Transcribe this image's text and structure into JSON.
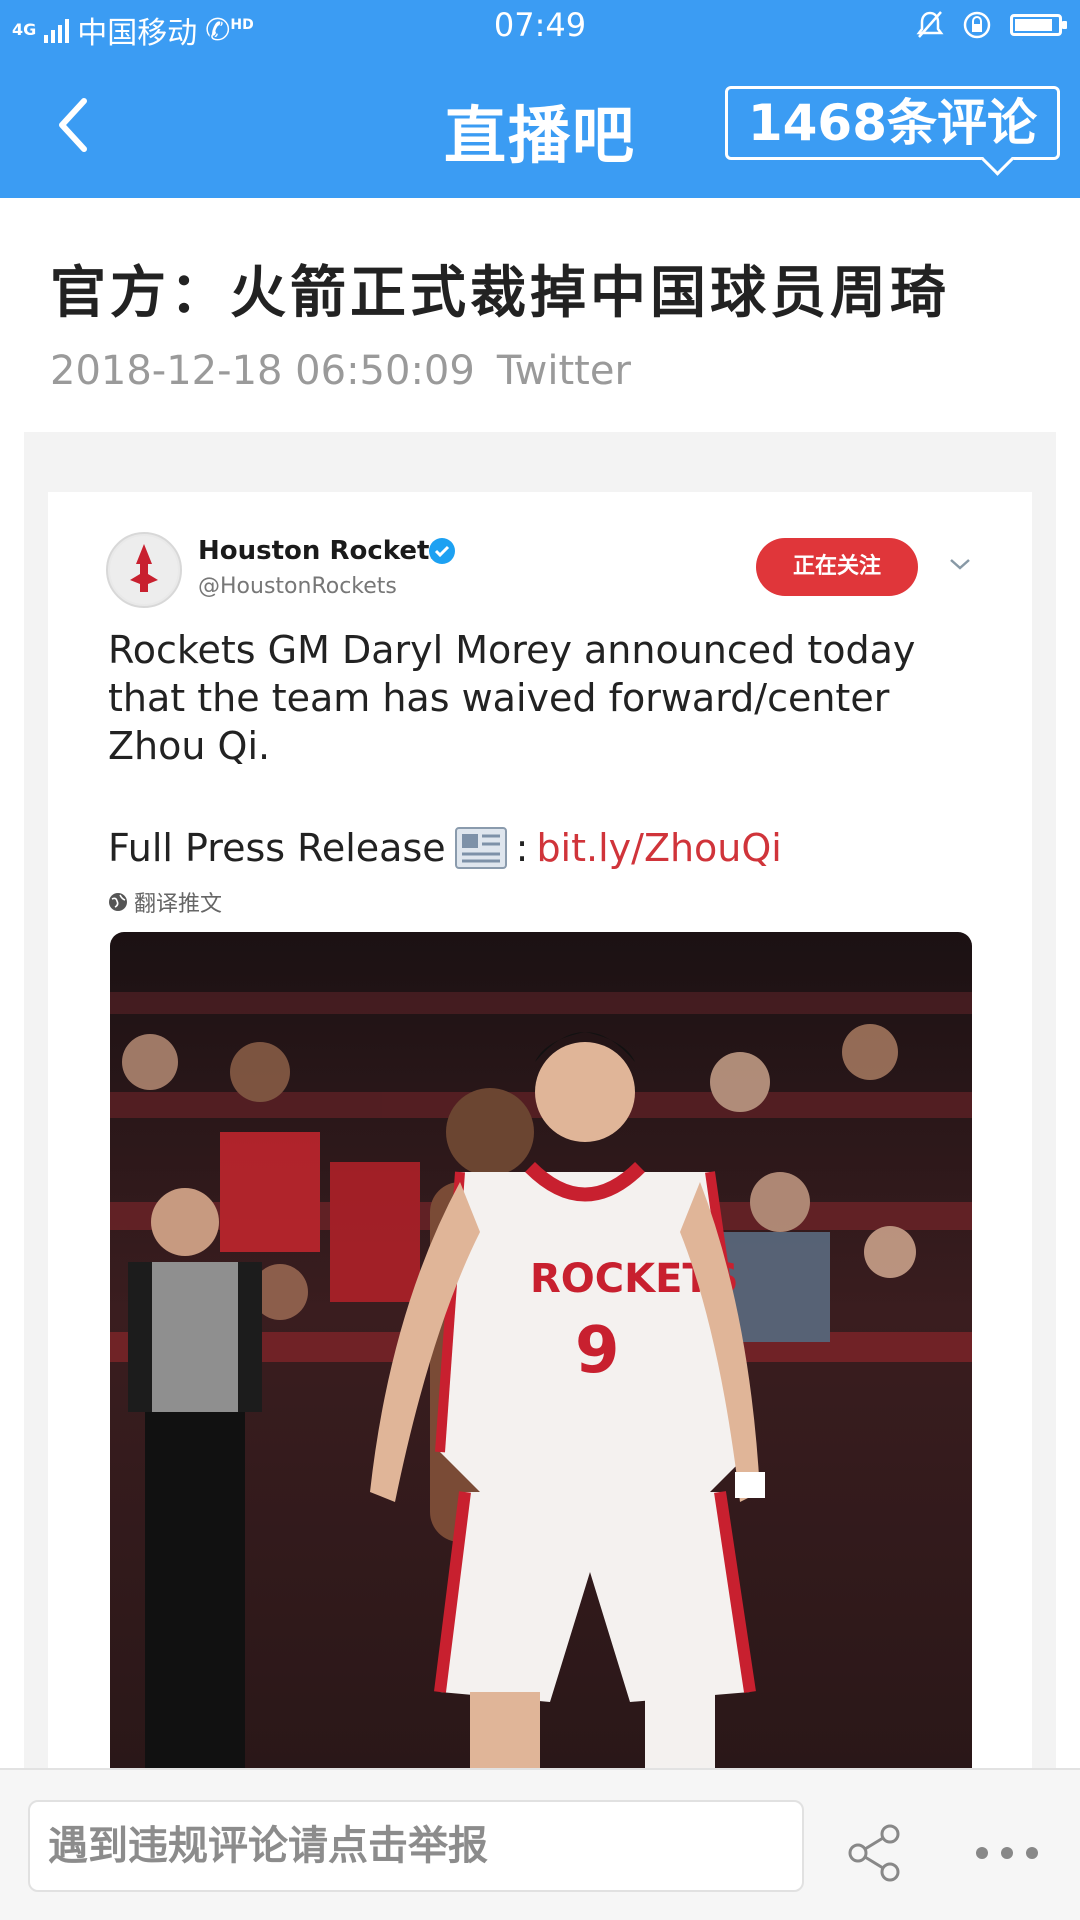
{
  "status_bar": {
    "network": "4G",
    "carrier": "中国移动",
    "hd": "HD",
    "time": "07:49"
  },
  "nav": {
    "title": "直播吧",
    "comments_label": "1468条评论"
  },
  "article": {
    "headline": "官方：火箭正式裁掉中国球员周琦",
    "datetime": "2018-12-18 06:50:09",
    "source": "Twitter"
  },
  "tweet": {
    "account_name": "Houston Rockets",
    "handle": "@HoustonRockets",
    "follow_label": "正在关注",
    "text": "Rockets GM Daryl Morey announced today that the team has waived forward/center Zhou Qi.",
    "press_label": "Full Press Release",
    "link": "bit.ly/ZhouQi",
    "translate_label": "翻译推文",
    "photo_alt": "Rockets player wearing jersey number 9",
    "jersey_text": "ROCKETS",
    "jersey_number": "9"
  },
  "bottom_bar": {
    "report_placeholder": "遇到违规评论请点击举报"
  },
  "colors": {
    "accent": "#3b9cf3",
    "follow": "#e0363a",
    "link": "#d0343a"
  },
  "icons": [
    "back-icon",
    "comment-bubble-icon",
    "verified-icon",
    "chevron-down-icon",
    "newspaper-icon",
    "globe-icon",
    "share-icon",
    "more-icon"
  ]
}
